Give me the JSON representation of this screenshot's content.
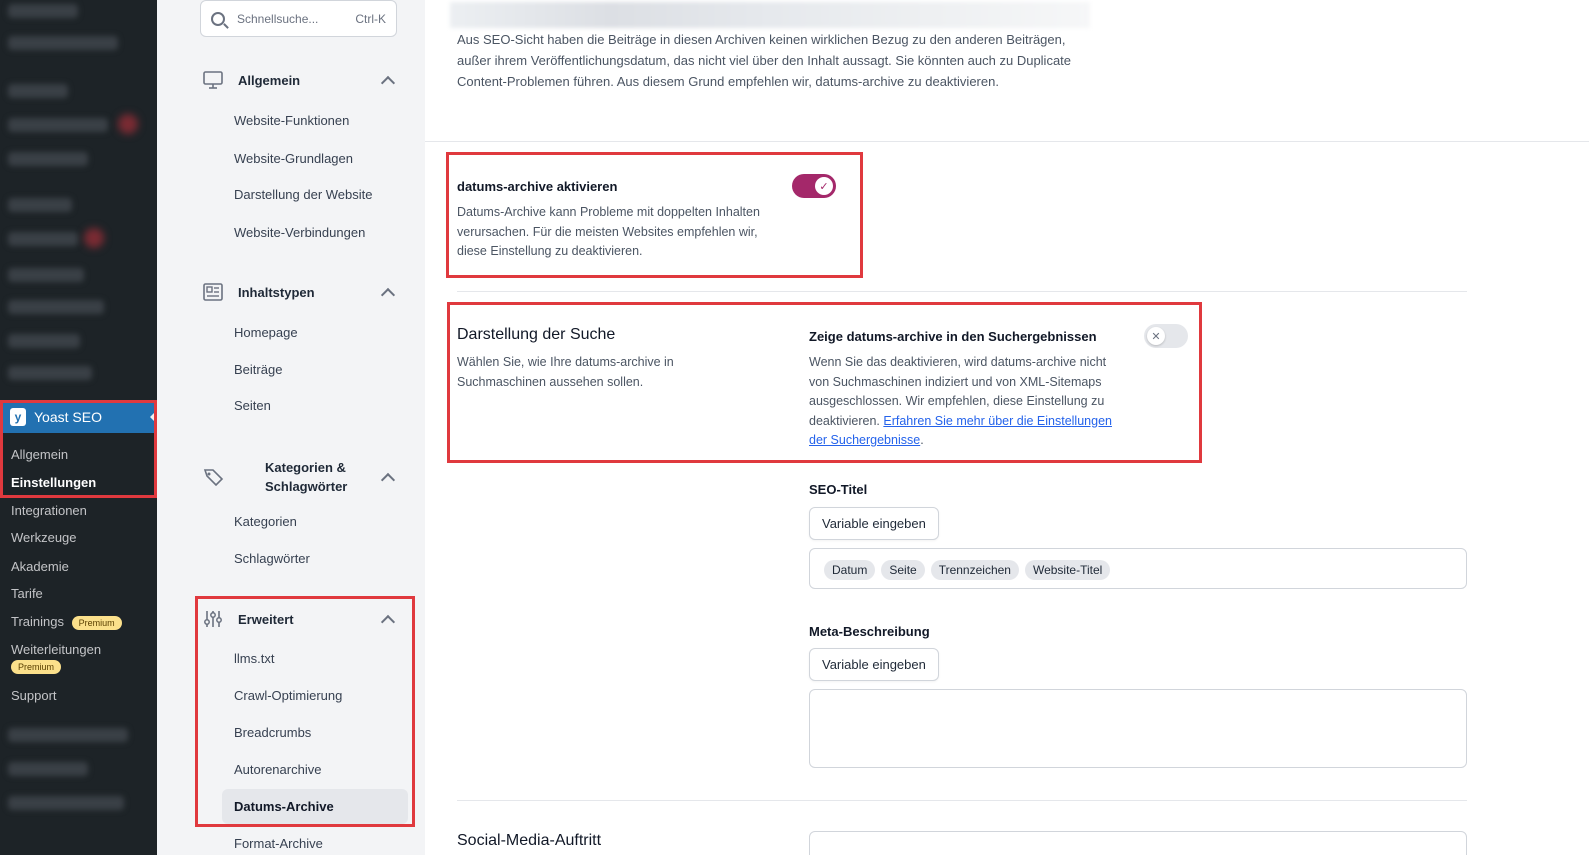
{
  "wp_menu": {
    "yoast_label": "Yoast SEO",
    "submenu": [
      {
        "label": "Allgemein"
      },
      {
        "label": "Einstellungen"
      },
      {
        "label": "Integrationen"
      },
      {
        "label": "Werkzeuge"
      },
      {
        "label": "Akademie"
      },
      {
        "label": "Tarife"
      },
      {
        "label": "Trainings",
        "badge": "Premium"
      },
      {
        "label": "Weiterleitungen",
        "badge": "Premium"
      },
      {
        "label": "Support"
      }
    ]
  },
  "settings_nav": {
    "search_placeholder": "Schnellsuche...",
    "search_shortcut": "Ctrl-K",
    "groups": [
      {
        "label": "Allgemein",
        "icon": "desktop-icon",
        "items": [
          "Website-Funktionen",
          "Website-Grundlagen",
          "Darstellung der Website",
          "Website-Verbindungen"
        ]
      },
      {
        "label": "Inhaltstypen",
        "icon": "newspaper-icon",
        "items": [
          "Homepage",
          "Beiträge",
          "Seiten"
        ]
      },
      {
        "label": "Kategorien & Schlagwörter",
        "icon": "tag-icon",
        "items": [
          "Kategorien",
          "Schlagwörter"
        ]
      },
      {
        "label": "Erweitert",
        "icon": "sliders-icon",
        "items": [
          "llms.txt",
          "Crawl-Optimierung",
          "Breadcrumbs",
          "Autorenarchive",
          "Datums-Archive",
          "Format-Archive"
        ]
      }
    ],
    "active_item": "Datums-Archive"
  },
  "main": {
    "intro_text": "Aus SEO-Sicht haben die Beiträge in diesen Archiven keinen wirklichen Bezug zu den anderen Beiträgen, außer ihrem Veröffentlichungsdatum, das nicht viel über den Inhalt aussagt. Sie könnten auch zu Duplicate Content-Problemen führen. Aus diesem Grund empfehlen wir, datums-archive zu deaktivieren.",
    "enable_setting": {
      "title": "datums-archive aktivieren",
      "description": "Datums-Archive kann Probleme mit doppelten Inhalten verursachen. Für die meisten Websites empfehlen wir, diese Einstellung zu deaktivieren.",
      "enabled": true
    },
    "search_appearance": {
      "title": "Darstellung der Suche",
      "description": "Wählen Sie, wie Ihre datums-archive in Suchmaschinen aussehen sollen.",
      "show_title": "Zeige datums-archive in den Suchergebnissen",
      "show_description": "Wenn Sie das deaktivieren, wird datums-archive nicht von Suchmaschinen indiziert und von XML-Sitemaps ausgeschlossen. Wir empfehlen, diese Einstellung zu deaktivieren.",
      "link_text": "Erfahren Sie mehr über die Einstellungen der Suchergebnisse",
      "link_suffix": ".",
      "enabled": false
    },
    "seo_title": {
      "label": "SEO-Titel",
      "button": "Variable eingeben",
      "chips": [
        "Datum",
        "Seite",
        "Trennzeichen",
        "Website-Titel"
      ]
    },
    "meta_description": {
      "label": "Meta-Beschreibung",
      "button": "Variable eingeben"
    },
    "next_section_title": "Social-Media-Auftritt"
  },
  "colors": {
    "wp_sidebar": "#1d2327",
    "wp_active": "#2271b1",
    "toggle_on": "#a4286a",
    "highlight_border": "#e0393e",
    "link": "#2563eb"
  }
}
